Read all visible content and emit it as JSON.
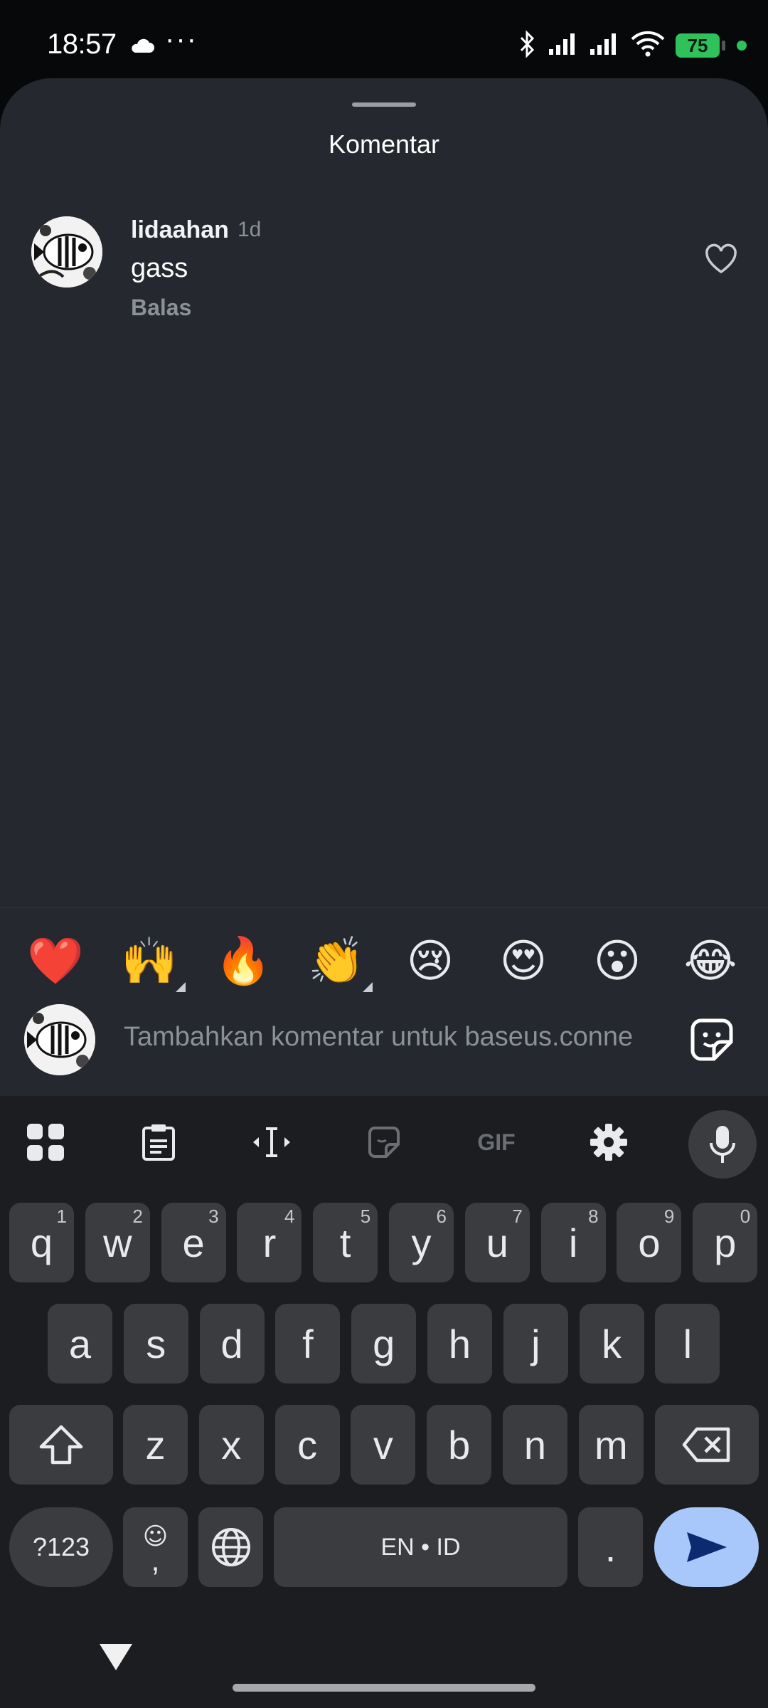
{
  "status_bar": {
    "time": "18:57",
    "dots": "···",
    "battery": "75",
    "icons": [
      "cloud-icon",
      "bluetooth-icon",
      "signal-icon",
      "signal-icon",
      "wifi-icon",
      "battery-icon"
    ]
  },
  "sheet": {
    "title": "Komentar"
  },
  "comments": [
    {
      "user": "lidaahan",
      "time": "1d",
      "text": "gass",
      "reply_label": "Balas"
    }
  ],
  "emojis": [
    "❤️",
    "🙌",
    "🔥",
    "👏",
    "😢",
    "😍",
    "😮",
    "😂"
  ],
  "compose": {
    "placeholder": "Tambahkan komentar untuk baseus.conne"
  },
  "keyboard": {
    "toolbar": [
      "apps-icon",
      "clipboard-icon",
      "text-cursor-icon",
      "sticker-icon",
      "gif-icon",
      "settings-icon",
      "mic-icon"
    ],
    "gif_label": "GIF",
    "row1": [
      {
        "k": "q",
        "h": "1"
      },
      {
        "k": "w",
        "h": "2"
      },
      {
        "k": "e",
        "h": "3"
      },
      {
        "k": "r",
        "h": "4"
      },
      {
        "k": "t",
        "h": "5"
      },
      {
        "k": "y",
        "h": "6"
      },
      {
        "k": "u",
        "h": "7"
      },
      {
        "k": "i",
        "h": "8"
      },
      {
        "k": "o",
        "h": "9"
      },
      {
        "k": "p",
        "h": "0"
      }
    ],
    "row2": [
      "a",
      "s",
      "d",
      "f",
      "g",
      "h",
      "j",
      "k",
      "l"
    ],
    "row3": [
      "z",
      "x",
      "c",
      "v",
      "b",
      "n",
      "m"
    ],
    "symbols_label": "?123",
    "emoji_comma_top": "☺",
    "emoji_comma_bottom": ",",
    "space_label": "EN • ID",
    "period_label": "."
  }
}
